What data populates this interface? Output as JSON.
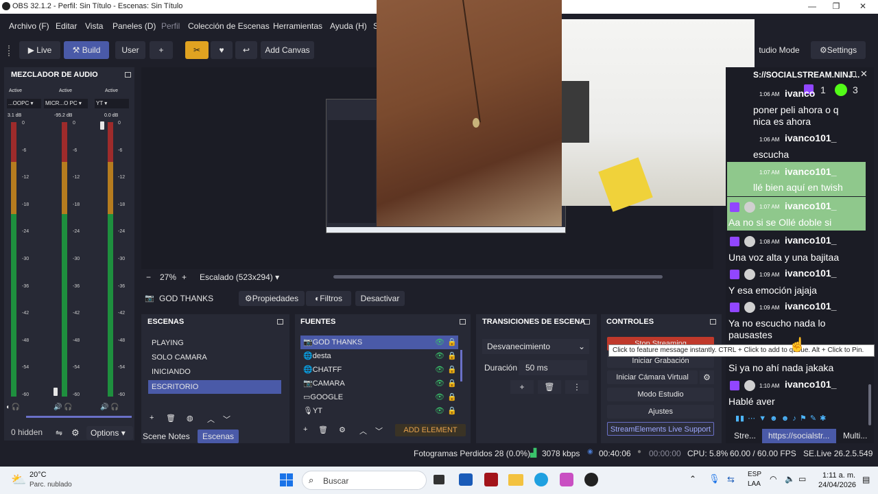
{
  "window": {
    "title": "OBS 32.1.2 - Perfil: Sin Título - Escenas: Sin Título"
  },
  "menu": {
    "items": [
      "Archivo (F)",
      "Editar",
      "Vista",
      "Paneles (D)",
      "Perfil",
      "Colección de Escenas",
      "Herramientas",
      "Ayuda (H)",
      "S"
    ]
  },
  "toolbar": {
    "live": "Live",
    "build": "Build",
    "user": "User",
    "plus": "+",
    "add_canvas": "Add Canvas",
    "studio_mode": "tudio Mode",
    "settings": "Settings"
  },
  "mixer": {
    "title": "MEZCLADOR DE AUDIO",
    "channels": [
      {
        "status": "Active",
        "name": "...OOPC",
        "db": "3.1 dB"
      },
      {
        "status": "Active",
        "name": "MICR...O PC",
        "db": "-95.2 dB"
      },
      {
        "status": "Active",
        "name": "YT",
        "db": "0.0 dB"
      }
    ],
    "ticks": [
      "0",
      "-6",
      "-12",
      "-18",
      "-24",
      "-30",
      "-36",
      "-42",
      "-48",
      "-54",
      "-60"
    ],
    "hidden": "0 hidden",
    "options": "Options"
  },
  "preview": {
    "zoom": "27%",
    "scaling": "Escalado (523x294)",
    "minus": "−",
    "plus": "+"
  },
  "source_bar": {
    "source": "GOD THANKS",
    "props": "Propiedades",
    "filters": "Filtros",
    "deactivate": "Desactivar"
  },
  "scenes": {
    "title": "ESCENAS",
    "items": [
      "PLAYING",
      "SOLO CAMARA",
      "INICIANDO",
      "ESCRITORIO"
    ],
    "tab_notes": "Scene Notes",
    "tab_scenes": "Escenas"
  },
  "sources": {
    "title": "FUENTES",
    "items": [
      "GOD THANKS",
      "desta",
      "CHATFF",
      "CAMARA",
      "GOOGLE",
      "YT"
    ],
    "add_element": "ADD ELEMENT"
  },
  "transitions": {
    "title": "TRANSICIONES DE ESCENA",
    "type": "Desvanecimiento",
    "duration_label": "Duración",
    "duration_value": "50 ms"
  },
  "controls": {
    "title": "CONTROLES",
    "stop_streaming": "Stop Streaming",
    "tooltip": "Click to feature message instantly. CTRL + Click to add to queue. Alt + Click to Pin.",
    "record": "Iniciar Grabación",
    "virtual_cam": "Iniciar Cámara Virtual",
    "studio": "Modo Estudio",
    "settings": "Ajustes",
    "streamelements": "StreamElements Live Support"
  },
  "chat": {
    "title": "S://SOCIALSTREAM.NINJ...",
    "counts": {
      "twitch": "1",
      "kick": "3"
    },
    "messages": [
      {
        "time": "1:06 AM",
        "user": "ivanco",
        "text": "poner peli ahora o q"
      },
      {
        "time": "",
        "user": "",
        "text": "nica es ahora"
      },
      {
        "time": "1:06 AM",
        "user": "ivanco101_",
        "text": "escucha"
      },
      {
        "time": "1:07 AM",
        "user": "ivanco101_",
        "text": "llé bien aquí en twish"
      },
      {
        "time": "1:07 AM",
        "user": "ivanco101_",
        "text": "Aa no si se Ollé doble si"
      },
      {
        "time": "1:08 AM",
        "user": "ivanco101_",
        "text": "Una voz alta y una bajitaa"
      },
      {
        "time": "1:09 AM",
        "user": "ivanco101_",
        "text": "Y esa emoción jajaja"
      },
      {
        "time": "1:09 AM",
        "user": "ivanco101_",
        "text": "Ya no escucho nada lo"
      },
      {
        "time": "",
        "user": "",
        "text": "pausastes"
      },
      {
        "time": "",
        "user": "",
        "text": "Si ya no ahí nada jakaka"
      },
      {
        "time": "1:10 AM",
        "user": "ivanco101_",
        "text": "Hablé aver"
      }
    ],
    "tabs": [
      "Stre...",
      "https://socialstr...",
      "Multi..."
    ]
  },
  "status": {
    "dropped": "Fotogramas Perdidos 28 (0.0%)",
    "bitrate": "3078 kbps",
    "live_time": "00:40:06",
    "rec_time": "00:00:00",
    "cpu": "CPU: 5.8%",
    "fps": "60.00 / 60.00 FPS",
    "version": "SE.Live 26.2.5.549"
  },
  "taskbar": {
    "weather_temp": "20°C",
    "weather_desc": "Parc. nublado",
    "search": "Buscar",
    "lang1": "ESP",
    "lang2": "LAA",
    "time": "1:11 a. m.",
    "date": "24/04/2026"
  }
}
